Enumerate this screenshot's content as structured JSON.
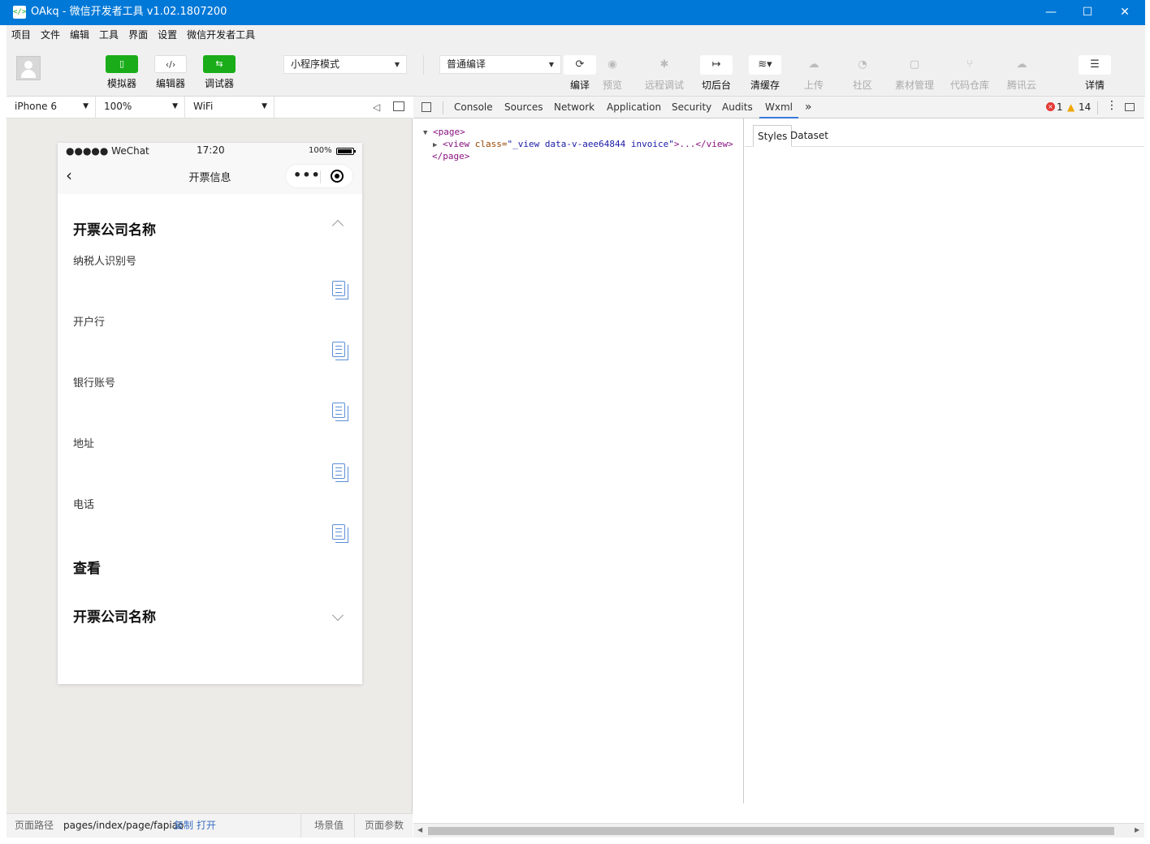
{
  "window": {
    "title": "OAkq - 微信开发者工具 v1.02.1807200",
    "minimize": "—",
    "maximize": "☐",
    "close": "✕"
  },
  "menu": [
    "项目",
    "文件",
    "编辑",
    "工具",
    "界面",
    "设置",
    "微信开发者工具"
  ],
  "toolbar": {
    "simulator": "模拟器",
    "editor": "编辑器",
    "debugger": "调试器",
    "mode_select": "小程序模式",
    "compile_select": "普通编译",
    "compile": "编译",
    "preview": "预览",
    "remote_debug": "远程调试",
    "background": "切后台",
    "clear_cache": "清缓存",
    "upload": "上传",
    "community": "社区",
    "assets": "素材管理",
    "repo": "代码仓库",
    "tencent_cloud": "腾讯云",
    "details": "详情"
  },
  "device_bar": {
    "device": "iPhone 6",
    "zoom": "100%",
    "network": "WiFi"
  },
  "phone": {
    "signal": "●●●●● WeChat",
    "time": "17:20",
    "battery": "100%",
    "nav_title": "开票信息",
    "section1_title": "开票公司名称",
    "fields": [
      "纳税人识别号",
      "开户行",
      "银行账号",
      "地址",
      "电话"
    ],
    "view_title": "查看",
    "section2_title": "开票公司名称"
  },
  "path_bar": {
    "label": "页面路径",
    "path": "pages/index/page/fapiao",
    "copy": "复制",
    "open": "打开",
    "scene": "场景值",
    "params": "页面参数"
  },
  "devtools": {
    "tabs": [
      "Console",
      "Sources",
      "Network",
      "Application",
      "Security",
      "Audits",
      "Wxml"
    ],
    "active_tab": "Wxml",
    "more": "»",
    "errors": "1",
    "warnings": "14",
    "wxml": {
      "page_open": "<page>",
      "view_open": "<view",
      "attr_name": "class=",
      "attr_value": "\"_view data-v-aee64844 invoice\"",
      "view_rest": ">...</view>",
      "page_close": "</page>"
    },
    "side_tabs": [
      "Styles",
      "Dataset"
    ]
  }
}
